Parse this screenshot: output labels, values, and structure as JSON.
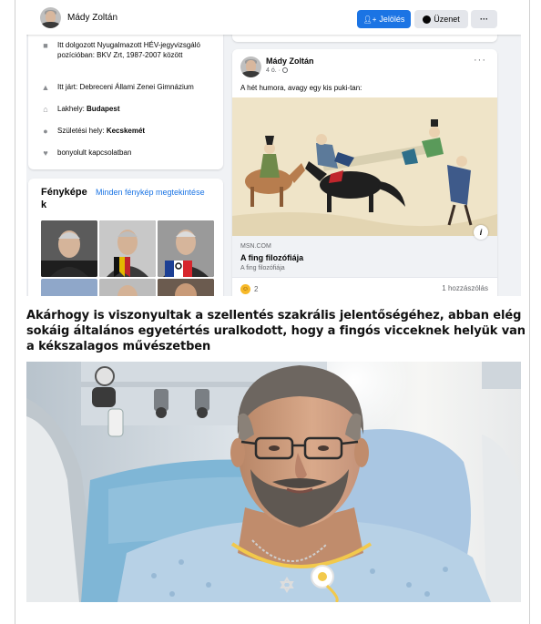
{
  "profile": {
    "name": "Mády Zoltán",
    "tag_button": "Jelölés",
    "message_button": "Üzenet",
    "more_button": "···"
  },
  "intro": {
    "work": "Itt dolgozott Nyugalmazott HÉV-jegyvizsgáló pozícióban: BKV Zrt, 1987-2007 között",
    "education": "Itt járt: Debreceni Állami Zenei Gimnázium",
    "lives_label": "Lakhely: ",
    "lives_value": "Budapest",
    "born_label": "Születési hely: ",
    "born_value": "Kecskemét",
    "relationship": "bonyolult kapcsolatban"
  },
  "photos": {
    "title": "Fényképe k",
    "see_all": "Minden fénykép megtekintése"
  },
  "post": {
    "author": "Mády Zoltán",
    "time": "4 ó. · ",
    "more": "···",
    "text": "A hét humora, avagy egy kis puki-tan:",
    "link_domain": "MSN.COM",
    "link_title": "A fing filozófiája",
    "link_subtitle": "A fing filozófiája",
    "info_icon": "i",
    "reaction_count": "2",
    "comments": "1 hozzászólás"
  },
  "article": {
    "headline": "Akárhogy is viszonyultak a szellentés szakrális jelentőségéhez, abban elég sokáig általános egyetértés uralkodott, hogy a fingós vicceknek helyük van a kékszalagos művészetben"
  },
  "colors": {
    "accent": "#1b74e4",
    "background": "#f0f2f5"
  }
}
